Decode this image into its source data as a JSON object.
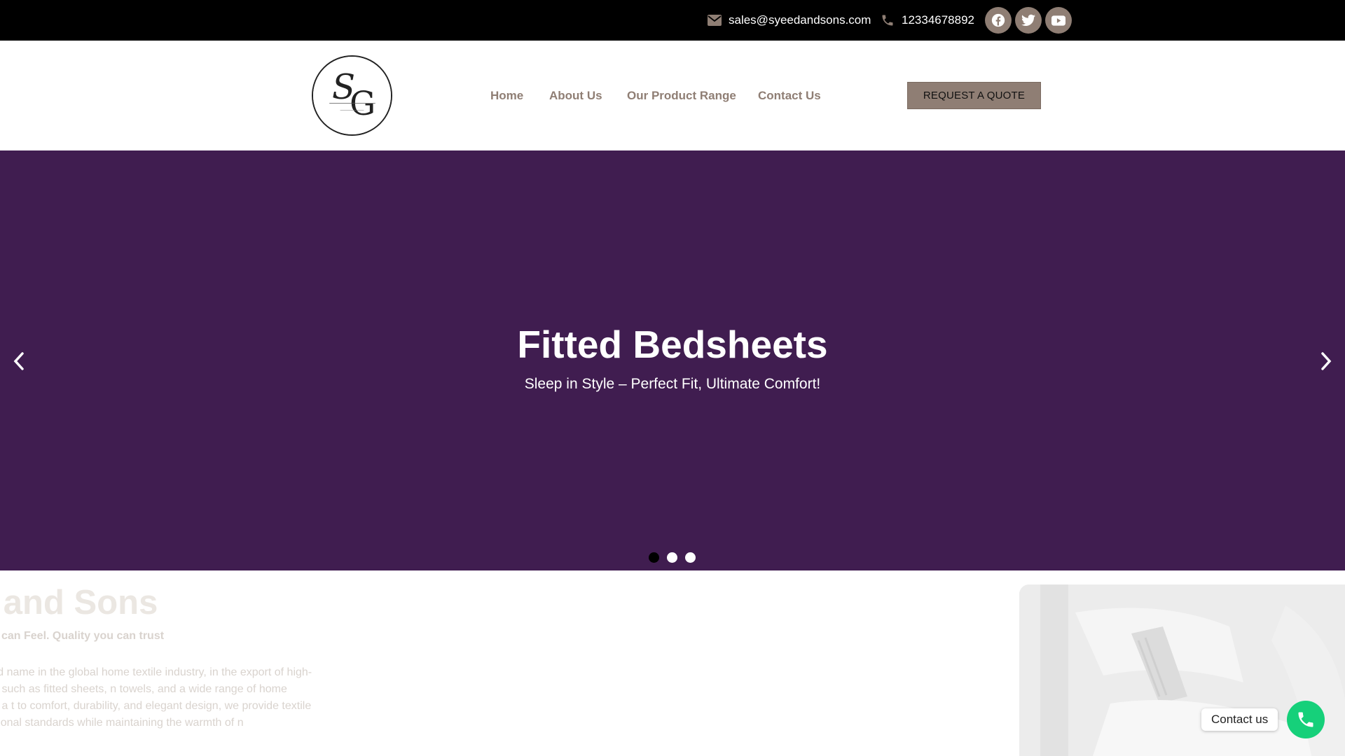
{
  "topbar": {
    "email": "sales@syeedandsons.com",
    "phone": "12334678892",
    "social": [
      {
        "icon": "facebook-icon"
      },
      {
        "icon": "twitter-icon"
      },
      {
        "icon": "youtube-icon"
      }
    ],
    "icon_color": "#8f7e74"
  },
  "header": {
    "nav": [
      {
        "label": "Home"
      },
      {
        "label": "About Us"
      },
      {
        "label": "Our Product Range"
      },
      {
        "label": "Contact Us"
      }
    ],
    "quote_button": "REQUEST A QUOTE",
    "accent": "#8f7e74"
  },
  "hero": {
    "title": "Fitted Bedsheets",
    "subtitle": "Sleep in Style – Perfect Fit, Ultimate Comfort!",
    "background": "#401d50",
    "slides_total": 3,
    "active_slide": 1
  },
  "about": {
    "title": "ed and Sons",
    "tagline": "ou can Feel. Quality you can trust",
    "body": "Sons is a trusted name in the global home textile industry, in the export of high-quality products such as fitted sheets, n towels, and a wide range of home essentials. With a t to comfort, durability, and elegant design, we provide textile at meet international standards while maintaining the warmth of n craftsmanship."
  },
  "floating_contact": {
    "label": "Contact us",
    "button_color": "#16d07a"
  }
}
